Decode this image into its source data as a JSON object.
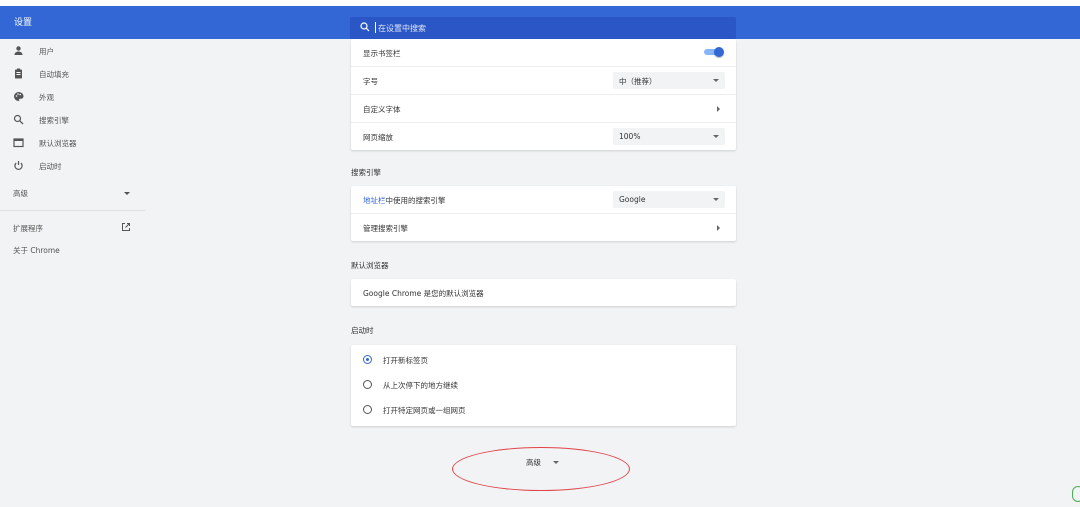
{
  "header": {
    "title": "设置",
    "search_placeholder": "在设置中搜索"
  },
  "sidebar": {
    "items": [
      {
        "label": "用户",
        "icon": "person-icon"
      },
      {
        "label": "自动填充",
        "icon": "clipboard-icon"
      },
      {
        "label": "外观",
        "icon": "palette-icon"
      },
      {
        "label": "搜索引擎",
        "icon": "search-icon"
      },
      {
        "label": "默认浏览器",
        "icon": "browser-icon"
      },
      {
        "label": "启动时",
        "icon": "power-icon"
      }
    ],
    "advanced": "高级",
    "extensions": "扩展程序",
    "about": "关于 Chrome"
  },
  "appearance": {
    "show_bookmarks": "显示书签栏",
    "show_bookmarks_on": true,
    "font_size_label": "字号",
    "font_size_value": "中（推荐）",
    "custom_fonts": "自定义字体",
    "page_zoom_label": "网页缩放",
    "page_zoom_value": "100%"
  },
  "search_engine": {
    "section_title": "搜索引擎",
    "address_bar_link": "地址栏",
    "address_bar_rest": "中使用的搜索引擎",
    "engine_value": "Google",
    "manage": "管理搜索引擎"
  },
  "default_browser": {
    "section_title": "默认浏览器",
    "status": "Google Chrome 是您的默认浏览器"
  },
  "on_startup": {
    "section_title": "启动时",
    "options": [
      {
        "label": "打开新标签页",
        "selected": true
      },
      {
        "label": "从上次停下的地方继续",
        "selected": false
      },
      {
        "label": "打开特定网页或一组网页",
        "selected": false
      }
    ]
  },
  "advanced_button": "高级",
  "colors": {
    "header": "#3367d6",
    "accent": "#3367d6",
    "highlight_ellipse": "#e0444a"
  }
}
